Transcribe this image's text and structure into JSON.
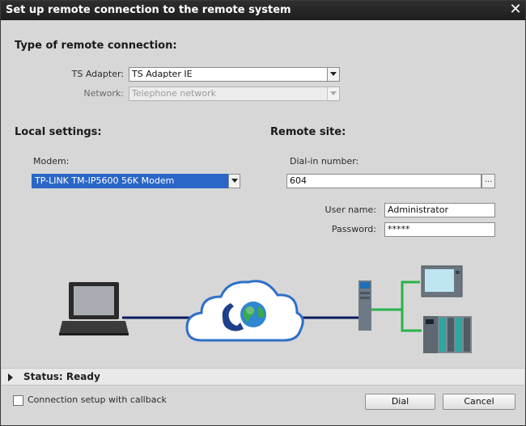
{
  "window": {
    "title": "Set up remote connection to the remote system",
    "close_glyph": "✕"
  },
  "remote_connection": {
    "heading": "Type of remote connection:",
    "ts_adapter_label": "TS Adapter:",
    "ts_adapter_value": "TS Adapter IE",
    "network_label": "Network:",
    "network_value": "Telephone network"
  },
  "local_settings": {
    "heading": "Local settings:",
    "modem_label": "Modem:",
    "modem_value": "TP-LINK TM-IP5600 56K Modem"
  },
  "remote_site": {
    "heading": "Remote site:",
    "dial_in_label": "Dial-in number:",
    "dial_in_value": "604",
    "browse_label": "...",
    "username_label": "User name:",
    "username_value": "Administrator",
    "password_label": "Password:",
    "password_value": "*****"
  },
  "status": {
    "text": "Status: Ready"
  },
  "footer": {
    "callback_label": "Connection setup with callback",
    "callback_checked": false,
    "dial_label": "Dial",
    "cancel_label": "Cancel"
  },
  "colors": {
    "selection_blue": "#2a66c8",
    "link_line_blue": "#0a1a5c",
    "link_line_green": "#29b34a",
    "cloud_outline": "#2e6fc9"
  },
  "icons": [
    "laptop-icon",
    "cloud-icon",
    "phone-icon",
    "globe-icon",
    "ts-adapter-icon",
    "hmi-panel-icon",
    "plc-rack-icon",
    "close-icon",
    "dropdown-arrow-icon",
    "expand-arrow-icon"
  ]
}
